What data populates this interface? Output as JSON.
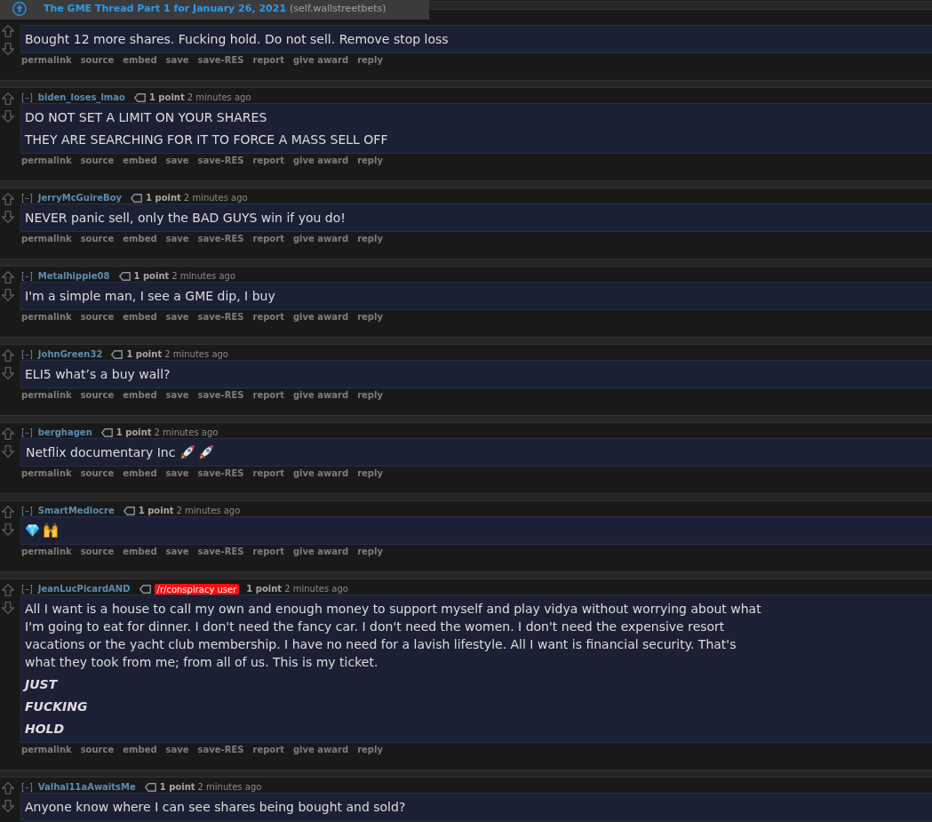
{
  "thread_bar": {
    "title": "The GME Thread Part 1 for January 26, 2021",
    "domain": "(self.wallstreetbets)"
  },
  "comments": [
    {
      "paragraphs": [
        {
          "kind": "plain",
          "text": "Bought 12 more shares. Fucking hold. Do not sell. Remove stop loss"
        }
      ],
      "actions": [
        "permalink",
        "source",
        "embed",
        "save",
        "save-RES",
        "report",
        "give award",
        "reply"
      ]
    },
    {
      "collapse": "[–]",
      "author": "biden_loses_lmao",
      "score": "1 point",
      "time": "2 minutes ago",
      "paragraphs": [
        {
          "kind": "plain",
          "text": "DO NOT SET A LIMIT ON YOUR SHARES"
        },
        {
          "kind": "plain",
          "text": "THEY ARE SEARCHING FOR IT TO FORCE A MASS SELL OFF"
        }
      ],
      "actions": [
        "permalink",
        "source",
        "embed",
        "save",
        "save-RES",
        "report",
        "give award",
        "reply"
      ]
    },
    {
      "collapse": "[–]",
      "author": "JerryMcGuireBoy",
      "score": "1 point",
      "time": "2 minutes ago",
      "paragraphs": [
        {
          "kind": "plain",
          "text": "NEVER panic sell, only the BAD GUYS win if you do!"
        }
      ],
      "actions": [
        "permalink",
        "source",
        "embed",
        "save",
        "save-RES",
        "report",
        "give award",
        "reply"
      ]
    },
    {
      "collapse": "[–]",
      "author": "Metalhippie08",
      "score": "1 point",
      "time": "2 minutes ago",
      "paragraphs": [
        {
          "kind": "plain",
          "text": "I'm a simple man, I see a GME dip, I buy"
        }
      ],
      "actions": [
        "permalink",
        "source",
        "embed",
        "save",
        "save-RES",
        "report",
        "give award",
        "reply"
      ]
    },
    {
      "collapse": "[–]",
      "author": "JohnGreen32",
      "score": "1 point",
      "time": "2 minutes ago",
      "paragraphs": [
        {
          "kind": "plain",
          "text": "ELI5 what’s a buy wall?"
        }
      ],
      "actions": [
        "permalink",
        "source",
        "embed",
        "save",
        "save-RES",
        "report",
        "give award",
        "reply"
      ]
    },
    {
      "collapse": "[–]",
      "author": "berghagen",
      "score": "1 point",
      "time": "2 minutes ago",
      "paragraphs": [
        {
          "kind": "plain",
          "text": "Netflix documentary Inc",
          "emoji": [
            {
              "kind": "rocket"
            },
            {
              "kind": "rocket"
            }
          ]
        }
      ],
      "actions": [
        "permalink",
        "source",
        "embed",
        "save",
        "save-RES",
        "report",
        "give award",
        "reply"
      ]
    },
    {
      "collapse": "[–]",
      "author": "SmartMediocre",
      "score": "1 point",
      "time": "2 minutes ago",
      "paragraphs": [
        {
          "kind": "plain",
          "emoji": [
            {
              "kind": "gem"
            },
            {
              "kind": "raised-hands"
            }
          ]
        }
      ],
      "actions": [
        "permalink",
        "source",
        "embed",
        "save",
        "save-RES",
        "report",
        "give award",
        "reply"
      ]
    },
    {
      "collapse": "[–]",
      "author": "JeanLucPicardAND",
      "flair": "/r/conspiracy user",
      "score": "1 point",
      "time": "2 minutes ago",
      "paragraphs": [
        {
          "kind": "plain",
          "text": "All I want is a house to call my own and enough money to support myself and play vidya without worrying about what I'm going to eat for dinner. I don't need the fancy car. I don't need the women. I don't need the expensive resort vacations or the yacht club membership. I have no need for a lavish lifestyle. All I want is financial security. That's what they took from me; from all of us. This is my ticket."
        },
        {
          "kind": "emphasis",
          "text": "JUST"
        },
        {
          "kind": "emphasis",
          "text": "FUCKING"
        },
        {
          "kind": "emphasis",
          "text": "HOLD"
        }
      ],
      "actions": [
        "permalink",
        "source",
        "embed",
        "save",
        "save-RES",
        "report",
        "give award",
        "reply"
      ]
    },
    {
      "collapse": "[–]",
      "author": "Valhal11aAwaitsMe",
      "score": "1 point",
      "time": "2 minutes ago",
      "paragraphs": [
        {
          "kind": "plain",
          "text": "Anyone know where I can see shares being bought and sold?"
        }
      ]
    }
  ]
}
